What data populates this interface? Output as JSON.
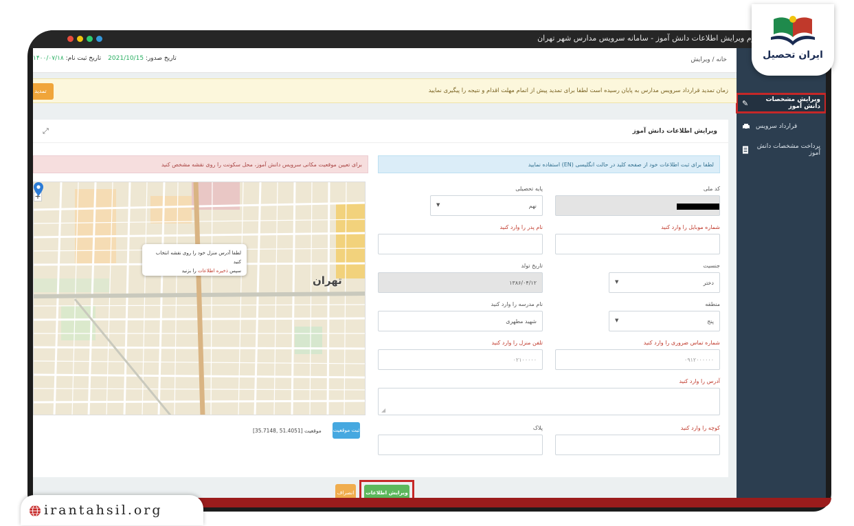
{
  "window": {
    "title": "فرم ویرایش اطلاعات دانش آموز - سامانه سرویس مدارس شهر تهران"
  },
  "header": {
    "issue_date_label": "تاریخ صدور:",
    "issue_date_value": "2021/10/15",
    "register_date_label": "تاریخ ثبت نام:",
    "register_date_value": "۱۴۰۰/۰۷/۱۸",
    "breadcrumb": "خانه / ویرایش"
  },
  "notice": {
    "text": "زمان تمدید قرارداد سرویس مدارس به پایان رسیده است لطفا برای تمدید پیش از اتمام مهلت اقدام و نتیجه را پیگیری نمایید",
    "button": "تمدید"
  },
  "sidebar": {
    "items": [
      {
        "label": "ویرایش مشخصات دانش آموز",
        "icon": "edit-icon",
        "active": true
      },
      {
        "label": "قرارداد سرویس",
        "icon": "car-icon",
        "active": false
      },
      {
        "label": "پرداخت مشخصات دانش آموز",
        "icon": "document-icon",
        "active": false
      }
    ]
  },
  "panel": {
    "title": "ویرایش اطلاعات دانش آموز",
    "info_alert": "لطفا برای ثبت اطلاعات خود از صفحه کلید در حالت انگلیسی (EN) استفاده نمایید",
    "danger_alert": "برای تعیین موقعیت مکانی سرویس دانش آموز، محل سکونت را روی نقشه مشخص کنید"
  },
  "form": {
    "national_code": {
      "label": "کد ملی"
    },
    "grade": {
      "label": "پایه تحصیلی",
      "value": "نهم"
    },
    "father_name": {
      "label": "نام پدر را وارد کنید"
    },
    "mobile": {
      "label": "شماره موبایل را وارد کنید"
    },
    "gender": {
      "label": "جنسیت",
      "value": "دختر"
    },
    "birth_date": {
      "label": "تاریخ تولد",
      "value": "۱۳۸۶/۰۴/۱۲"
    },
    "district": {
      "label": "منطقه",
      "value": "پنج"
    },
    "school": {
      "label": "نام مدرسه را وارد کنید",
      "value": "شهید مطهری"
    },
    "emergency_phone": {
      "label": "شماره تماس ضروری را وارد کنید",
      "placeholder": "۰۹۱۲۰۰۰۰۰۰"
    },
    "home_phone": {
      "label": "تلفن منزل را وارد کنید",
      "placeholder": "۰۲۱۰۰۰۰۰"
    },
    "address": {
      "label": "آدرس را وارد کنید"
    },
    "alley": {
      "label": "کوچه را وارد کنید"
    },
    "plaque": {
      "label": "پلاک"
    }
  },
  "map": {
    "city": "تهران",
    "popup_line1": "لطفا آدرس منزل خود را روی نقشه انتخاب کنید",
    "popup_line2_pre": "سپس",
    "popup_highlight": "ذخیره اطلاعات",
    "popup_line2_post": "را بزنید",
    "zoom_in": "+",
    "coords": "[35.7148, 51.4051] موقعیت",
    "locate_button": "ثبت موقعیت"
  },
  "actions": {
    "cancel": "انصراف",
    "save": "ویرایش اطلاعات"
  },
  "logo": {
    "text": "ایران تحصیل"
  },
  "watermark": {
    "text": "irantahsil.org"
  },
  "colors": {
    "sidebar": "#2c3e50",
    "highlight": "#c62828",
    "save": "#5cb85c",
    "cancel": "#f0ad4e",
    "info": "#dbedf8",
    "danger": "#f6dede"
  }
}
